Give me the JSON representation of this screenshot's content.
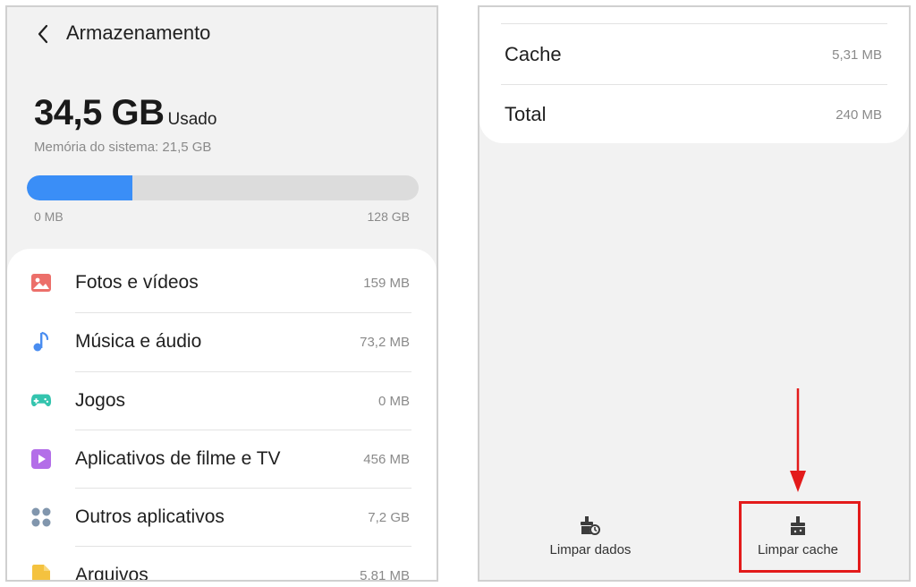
{
  "storage": {
    "title": "Armazenamento",
    "used_amount": "34,5 GB",
    "used_label": "Usado",
    "system_memory": "Memória do sistema: 21,5 GB",
    "bar_min": "0 MB",
    "bar_max": "128 GB",
    "used_fraction": 0.27
  },
  "categories": [
    {
      "label": "Fotos e vídeos",
      "size": "159 MB",
      "icon": "image-icon",
      "color": "#ec6f6a"
    },
    {
      "label": "Música e áudio",
      "size": "73,2 MB",
      "icon": "music-note-icon",
      "color": "#4a8df0"
    },
    {
      "label": "Jogos",
      "size": "0 MB",
      "icon": "gamepad-icon",
      "color": "#34c4ae"
    },
    {
      "label": "Aplicativos de filme e TV",
      "size": "456 MB",
      "icon": "play-icon",
      "color": "#b36ee8"
    },
    {
      "label": "Outros aplicativos",
      "size": "7,2 GB",
      "icon": "apps-grid-icon",
      "color": "#8196ad"
    },
    {
      "label": "Arquivos",
      "size": "5,81 MB",
      "icon": "file-icon",
      "color": "#f4c23f"
    }
  ],
  "details": {
    "cache_label": "Cache",
    "cache_value": "5,31 MB",
    "total_label": "Total",
    "total_value": "240 MB"
  },
  "actions": {
    "clear_data": "Limpar dados",
    "clear_cache": "Limpar cache"
  },
  "colors": {
    "accent": "#3a8ef7",
    "highlight": "#e31b1b"
  }
}
